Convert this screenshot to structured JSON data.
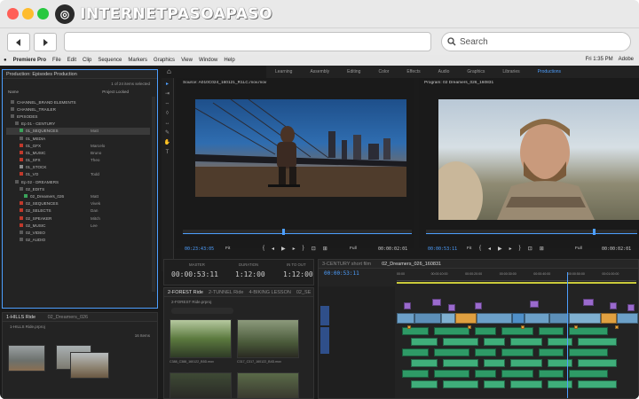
{
  "browser": {
    "logo_text": "INTERNETPASOAPASO",
    "logo_text_part1": "INTERNET",
    "logo_text_part2": "PASOAPASO",
    "search_label": "Search",
    "back_icon": "arrow-left-icon",
    "forward_icon": "arrow-right-icon",
    "colors": {
      "close": "#ff5f57",
      "minimize": "#febc2e",
      "maximize": "#28c840"
    }
  },
  "app": {
    "menu": [
      "Premiere Pro",
      "File",
      "Edit",
      "Clip",
      "Sequence",
      "Markers",
      "Graphics",
      "View",
      "Window",
      "Help"
    ],
    "clock": "Fri 1:35 PM",
    "user": "Adobe",
    "workspaces": [
      "Learning",
      "Assembly",
      "Editing",
      "Color",
      "Effects",
      "Audio",
      "Graphics",
      "Libraries",
      "Productions"
    ],
    "active_workspace": "Productions"
  },
  "project": {
    "title": "Production: Episodes Production",
    "selected": "1 of 24 items selected",
    "col_name": "Name",
    "col_project": "Project Locked",
    "rows": [
      {
        "name": "CHANNEL_BRAND ELEMENTS",
        "sub": ""
      },
      {
        "name": "CHANNEL_TRAILER",
        "sub": ""
      },
      {
        "name": "EPISODES",
        "sub": ""
      },
      {
        "name": "Ep 01 - CENTURY",
        "sub": ""
      },
      {
        "name": "01_SEQUENCES",
        "sub": "Matt"
      },
      {
        "name": "01_MEDIA",
        "sub": ""
      },
      {
        "name": "01_GFX",
        "sub": "Marcelo"
      },
      {
        "name": "01_MUSIC",
        "sub": "Bruno"
      },
      {
        "name": "01_SFX",
        "sub": "Theo"
      },
      {
        "name": "01_STOCK",
        "sub": ""
      },
      {
        "name": "01_VO",
        "sub": "Todd"
      },
      {
        "name": "Ep 02 - DREAMERS",
        "sub": ""
      },
      {
        "name": "02_EDITS",
        "sub": ""
      },
      {
        "name": "02_Dreamers_026",
        "sub": "Matt"
      },
      {
        "name": "02_SEQUENCES",
        "sub": "Vivek"
      },
      {
        "name": "02_SELECTS",
        "sub": "Dan"
      },
      {
        "name": "02_SPEAKER",
        "sub": "Mitch"
      },
      {
        "name": "02_MUSIC",
        "sub": "Lee"
      },
      {
        "name": "02_VIDEO",
        "sub": ""
      },
      {
        "name": "02_AUDIO",
        "sub": ""
      }
    ]
  },
  "bin_panel": {
    "title": "1-HILLS Ride",
    "tab2": "02_Dreamers_026",
    "path": "1-HILLS Ride.prproj",
    "count": "16 Items"
  },
  "source": {
    "title": "Source: A010C024_160121_R1LC.mov.mov",
    "tc_in": "00:23:43:05",
    "fit": "Fit",
    "full": "Full",
    "tc_out": "00:00:02:01"
  },
  "program": {
    "title": "Program: 02 Dreamers_026_160831",
    "tc_in": "00:00:53:11",
    "fit": "Fit",
    "full": "Full",
    "tc_out": "00:00:02:01"
  },
  "timecodes": {
    "master_label": "MASTER",
    "master": "00:00:53:11",
    "duration_label": "DURATION",
    "duration": "1:12:00",
    "inout_label": "IN TO OUT",
    "inout": "1:12:00"
  },
  "media_bin": {
    "tabs": [
      "2-FOREST Ride",
      "2-TUNNEL Ride",
      "4-BIKING LESSON",
      "02_SE"
    ],
    "path": "2-FOREST Ride.prproj",
    "clips": [
      "C388_C388_160122_B5D.mov",
      "C317_C317_160122_B4D.mov"
    ]
  },
  "timeline": {
    "tabs": [
      "3-CENTURY short film",
      "02_Dreamers_026_160831"
    ],
    "tc": "00:00:53:11",
    "ruler": [
      "00:00",
      "00:00:10:00",
      "00:00:20:00",
      "00:00:30:00",
      "00:00:40:00",
      "00:00:50:00",
      "00:01:00:00"
    ]
  }
}
